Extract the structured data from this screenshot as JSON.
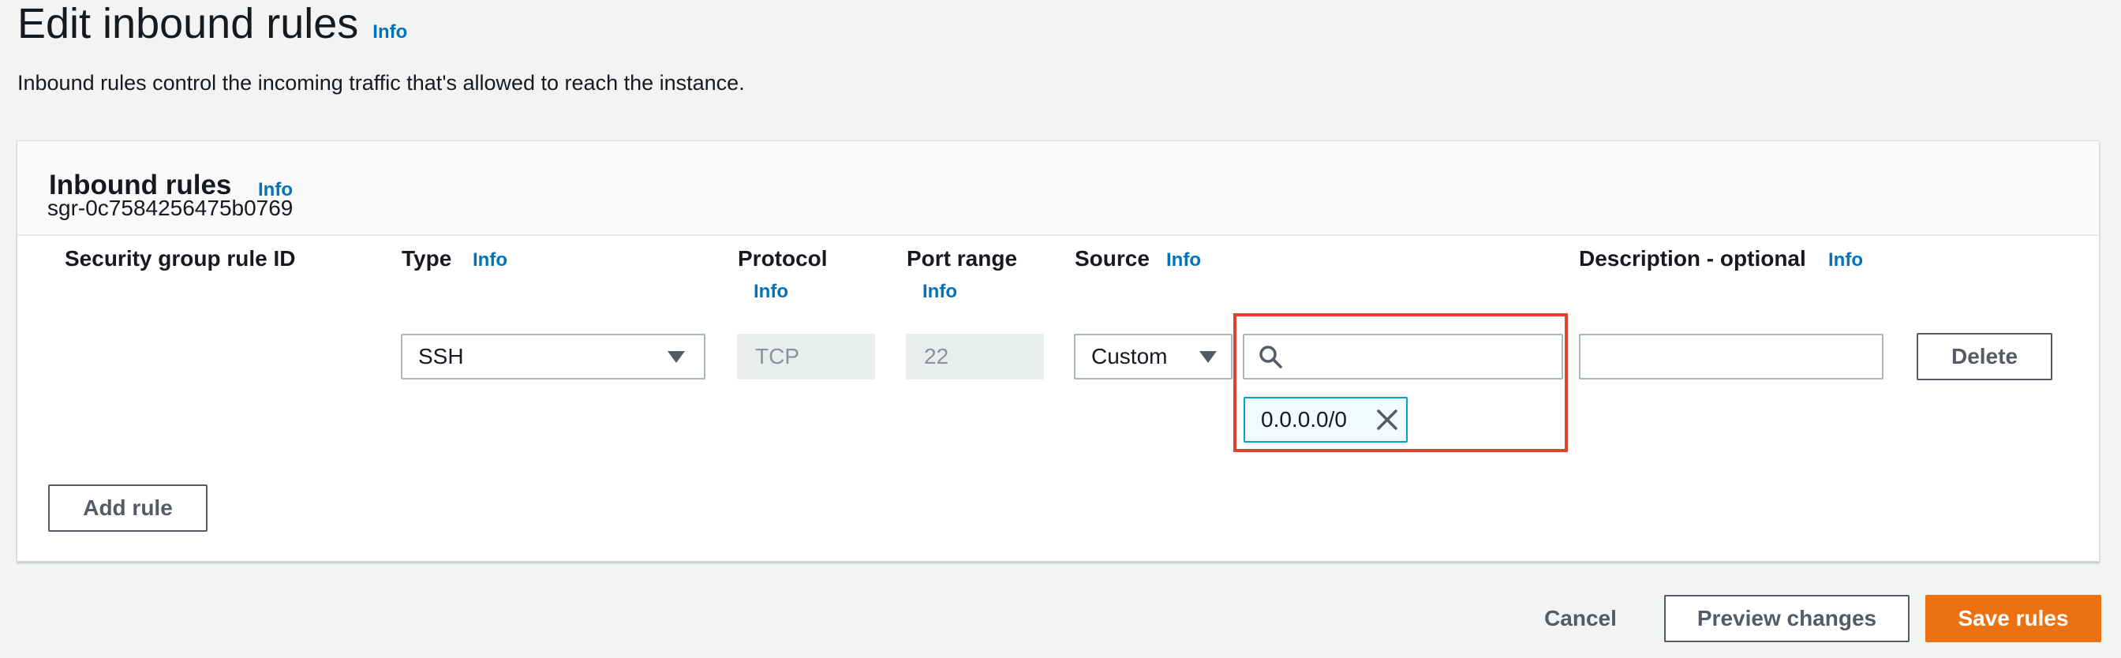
{
  "page": {
    "title": "Edit inbound rules",
    "title_info": "Info",
    "description": "Inbound rules control the incoming traffic that's allowed to reach the instance."
  },
  "panel": {
    "title": "Inbound rules",
    "info": "Info"
  },
  "columns": {
    "rule_id": "Security group rule ID",
    "type": "Type",
    "type_info": "Info",
    "protocol": "Protocol",
    "protocol_info": "Info",
    "port_range": "Port range",
    "port_range_info": "Info",
    "source": "Source",
    "source_info": "Info",
    "description": "Description - optional",
    "description_info": "Info"
  },
  "rule": {
    "id": "sgr-0c7584256475b0769",
    "type": "SSH",
    "protocol": "TCP",
    "port_range": "22",
    "source_mode": "Custom",
    "source_search_value": "",
    "source_token": "0.0.0.0/0",
    "description_value": "",
    "delete_label": "Delete"
  },
  "actions": {
    "add_rule": "Add rule",
    "cancel": "Cancel",
    "preview": "Preview changes",
    "save": "Save rules"
  },
  "colors": {
    "accent_orange": "#ec7211",
    "info_blue": "#0073bb",
    "highlight_red": "#e0432b",
    "token_border": "#00a1c9"
  },
  "icons": {
    "select_caret": "caret-down-icon",
    "search": "search-icon",
    "token_remove": "close-icon"
  }
}
